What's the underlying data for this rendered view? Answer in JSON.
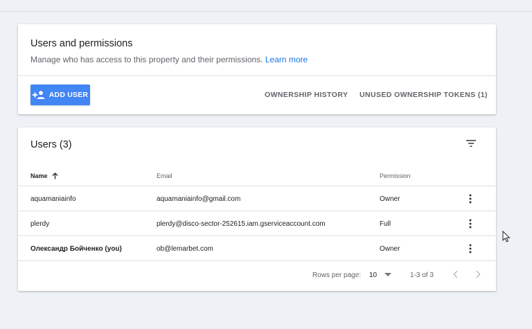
{
  "permissions": {
    "title": "Users and permissions",
    "description": "Manage who has access to this property and their permissions.",
    "learn_more": "Learn more",
    "add_user": "ADD USER",
    "ownership_history": "OWNERSHIP HISTORY",
    "unused_tokens": "UNUSED OWNERSHIP TOKENS (1)"
  },
  "users": {
    "title": "Users (3)",
    "columns": {
      "name": "Name",
      "email": "Email",
      "permission": "Permission"
    },
    "rows": [
      {
        "name": "aquamaniainfo",
        "email": "aquamaniainfo@gmail.com",
        "permission": "Owner"
      },
      {
        "name": "plerdy",
        "email": "plerdy@disco-sector-252615.iam.gserviceaccount.com",
        "permission": "Full"
      },
      {
        "name": "Олександр Бойченко (you)",
        "email": "ob@lemarbet.com",
        "permission": "Owner"
      }
    ],
    "footer": {
      "rows_per_page_label": "Rows per page:",
      "rows_per_page_value": "10",
      "range": "1-3 of 3"
    }
  },
  "colors": {
    "accent": "#4285f4",
    "link": "#1a73e8",
    "background": "#eef1f6"
  },
  "icons": [
    "add-person-icon",
    "filter-icon",
    "sort-arrow-up-icon",
    "more-vert-icon",
    "dropdown-caret-icon",
    "chevron-left-icon",
    "chevron-right-icon",
    "mouse-cursor-icon"
  ]
}
